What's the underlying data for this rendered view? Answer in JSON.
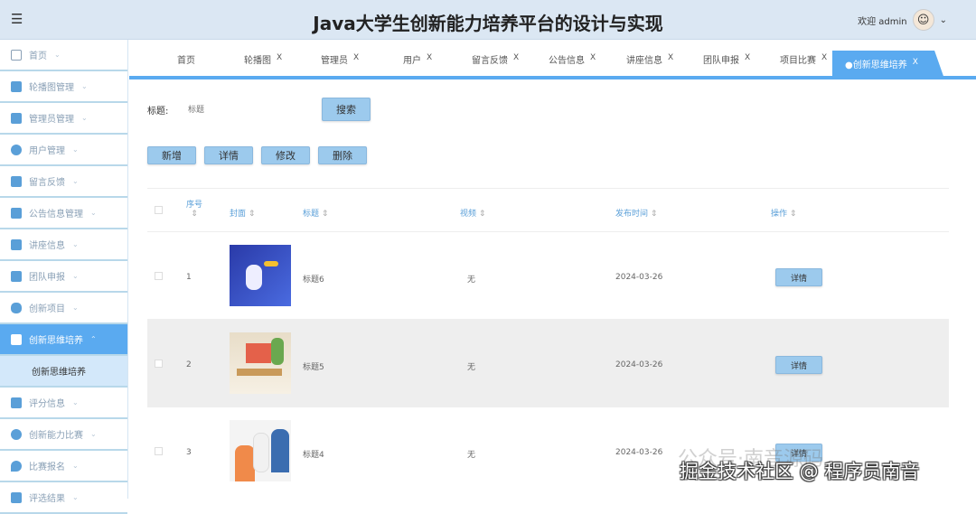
{
  "header": {
    "title": "Java大学生创新能力培养平台的设计与实现",
    "welcome": "欢迎 admin",
    "menu_icon": "hamburger-icon"
  },
  "sidebar": {
    "items": [
      {
        "label": "首页"
      },
      {
        "label": "轮播图管理"
      },
      {
        "label": "管理员管理"
      },
      {
        "label": "用户管理"
      },
      {
        "label": "留言反馈"
      },
      {
        "label": "公告信息管理"
      },
      {
        "label": "讲座信息"
      },
      {
        "label": "团队申报"
      },
      {
        "label": "创新项目"
      },
      {
        "label": "创新思维培养",
        "active": true
      }
    ],
    "sub_item": "创新思维培养",
    "items_after": [
      {
        "label": "评分信息"
      },
      {
        "label": "创新能力比赛"
      },
      {
        "label": "比赛报名"
      },
      {
        "label": "评选结果"
      }
    ]
  },
  "tabs": [
    {
      "label": "首页"
    },
    {
      "label": "轮播图"
    },
    {
      "label": "管理员"
    },
    {
      "label": "用户"
    },
    {
      "label": "留言反馈"
    },
    {
      "label": "公告信息"
    },
    {
      "label": "讲座信息"
    },
    {
      "label": "团队申报"
    },
    {
      "label": "项目比赛"
    },
    {
      "label": "●创新思维培养"
    }
  ],
  "tab_close": "X",
  "search": {
    "label": "标题:",
    "placeholder": "标题",
    "button": "搜索"
  },
  "actions": {
    "add": "新增",
    "detail": "详情",
    "edit": "修改",
    "delete": "删除"
  },
  "table": {
    "columns": [
      "序号",
      "封面",
      "标题",
      "视频",
      "发布时间",
      "操作"
    ],
    "sort": "⇕",
    "rows": [
      {
        "index": "1",
        "title": "标题6",
        "video": "无",
        "date": "2024-03-26",
        "action": "详情"
      },
      {
        "index": "2",
        "title": "标题5",
        "video": "无",
        "date": "2024-03-26",
        "action": "详情"
      },
      {
        "index": "3",
        "title": "标题4",
        "video": "无",
        "date": "2024-03-26",
        "action": "详情"
      }
    ]
  },
  "watermark": {
    "line1": "公众号·南音源码",
    "line2": "掘金技术社区 @ 程序员南音"
  }
}
